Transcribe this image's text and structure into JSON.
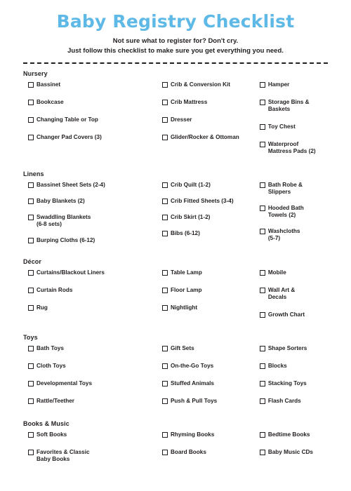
{
  "header": {
    "title": "Baby Registry Checklist",
    "subtitle_line1": "Not sure what to register for? Don't cry.",
    "subtitle_line2": "Just follow this checklist to make sure you get everything you need.",
    "title_color": "#5fb9e6",
    "text_color": "#231f20"
  },
  "sections": [
    {
      "id": "nursery",
      "title": "Nursery",
      "columns": [
        [
          "Bassinet",
          "Bookcase",
          "Changing Table or Top",
          "Changer Pad Covers (3)"
        ],
        [
          "Crib & Conversion Kit",
          "Crib Mattress",
          "Dresser",
          "Glider/Rocker & Ottoman"
        ],
        [
          "Hamper",
          "Storage Bins &\nBaskets",
          "Toy Chest",
          "Waterproof\nMattress Pads (2)"
        ]
      ]
    },
    {
      "id": "linens",
      "title": "Linens",
      "columns": [
        [
          "Bassinet Sheet Sets (2-4)",
          "Baby Blankets (2)",
          "Swaddling Blankets\n(6-8 sets)",
          "Burping Cloths (6-12)"
        ],
        [
          "Crib Quilt (1-2)",
          "Crib Fitted Sheets (3-4)",
          "Crib Skirt (1-2)",
          "Bibs (6-12)"
        ],
        [
          "Bath Robe &\nSlippers",
          "Hooded Bath\nTowels (2)",
          "Washcloths\n(5-7)"
        ]
      ]
    },
    {
      "id": "decor",
      "title": "Décor",
      "columns": [
        [
          "Curtains/Blackout Liners",
          "Curtain Rods",
          "Rug"
        ],
        [
          "Table Lamp",
          "Floor Lamp",
          "Nightlight"
        ],
        [
          "Mobile",
          "Wall Art &\nDecals",
          "Growth Chart"
        ]
      ]
    },
    {
      "id": "toys",
      "title": "Toys",
      "columns": [
        [
          "Bath Toys",
          "Cloth Toys",
          "Developmental Toys",
          "Rattle/Teether"
        ],
        [
          "Gift Sets",
          "On-the-Go Toys",
          "Stuffed Animals",
          "Push & Pull Toys"
        ],
        [
          "Shape Sorters",
          "Blocks",
          "Stacking Toys",
          "Flash Cards"
        ]
      ]
    },
    {
      "id": "books",
      "title": "Books & Music",
      "columns": [
        [
          "Soft Books",
          "Favorites & Classic\nBaby Books"
        ],
        [
          "Rhyming Books",
          "Board Books"
        ],
        [
          "Bedtime Books",
          "Baby Music CDs"
        ]
      ]
    }
  ]
}
